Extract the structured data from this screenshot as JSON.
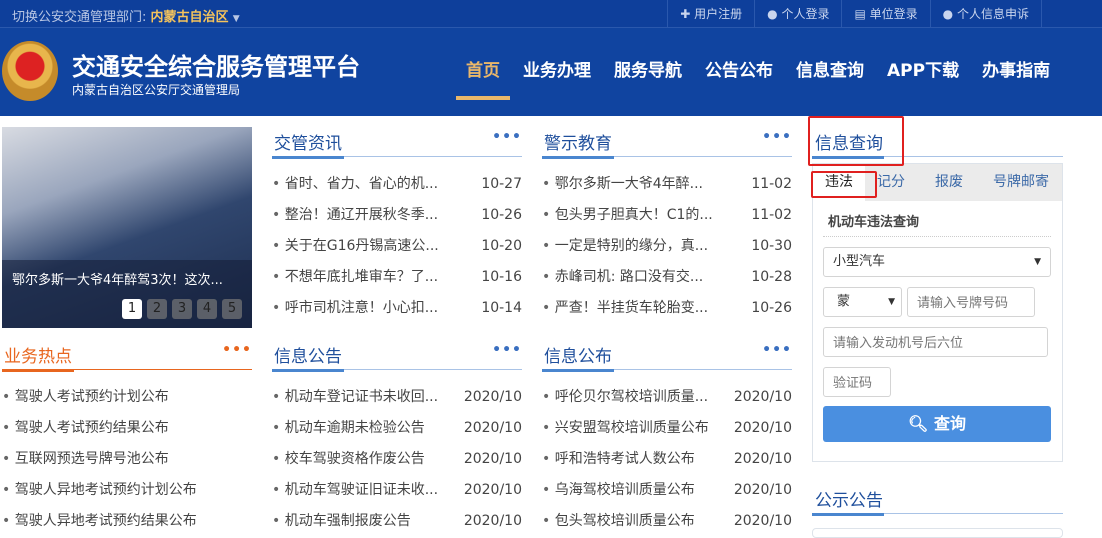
{
  "topbar": {
    "dept_label": "切换公安交通管理部门:",
    "dept_value": "内蒙古自治区",
    "links": [
      "用户注册",
      "个人登录",
      "单位登录",
      "个人信息申诉"
    ]
  },
  "header": {
    "title": "交通安全综合服务管理平台",
    "subtitle": "内蒙古自治区公安厅交通管理局",
    "nav": [
      "首页",
      "业务办理",
      "服务导航",
      "公告公布",
      "信息查询",
      "APP下载",
      "办事指南"
    ]
  },
  "carousel": {
    "caption": "鄂尔多斯一大爷4年醉驾3次！这次...",
    "pages": [
      "1",
      "2",
      "3",
      "4",
      "5"
    ],
    "active": 1
  },
  "more": "•••",
  "hot": {
    "title": "业务热点",
    "items": [
      "驾驶人考试预约计划公布",
      "驾驶人考试预约结果公布",
      "互联网预选号牌号池公布",
      "驾驶人异地考试预约计划公布",
      "驾驶人异地考试预约结果公布"
    ]
  },
  "news": {
    "title": "交管资讯",
    "items": [
      {
        "t": "省时、省力、省心的机...",
        "d": "10-27"
      },
      {
        "t": "整治！通辽开展秋冬季...",
        "d": "10-26"
      },
      {
        "t": "关于在G16丹锡高速公...",
        "d": "10-20"
      },
      {
        "t": "不想年底扎堆审车？了...",
        "d": "10-16"
      },
      {
        "t": "呼市司机注意！小心扣...",
        "d": "10-14"
      }
    ]
  },
  "warn": {
    "title": "警示教育",
    "items": [
      {
        "t": "鄂尔多斯一大爷4年醉...",
        "d": "11-02"
      },
      {
        "t": "包头男子胆真大！C1的...",
        "d": "11-02"
      },
      {
        "t": "一定是特别的缘分，真...",
        "d": "10-30"
      },
      {
        "t": "赤峰司机: 路口没有交...",
        "d": "10-28"
      },
      {
        "t": "严查！半挂货车轮胎变...",
        "d": "10-26"
      }
    ]
  },
  "notice": {
    "title": "信息公告",
    "items": [
      {
        "t": "机动车登记证书未收回...",
        "d": "2020/10"
      },
      {
        "t": "机动车逾期未检验公告",
        "d": "2020/10"
      },
      {
        "t": "校车驾驶资格作废公告",
        "d": "2020/10"
      },
      {
        "t": "机动车驾驶证旧证未收...",
        "d": "2020/10"
      },
      {
        "t": "机动车强制报废公告",
        "d": "2020/10"
      }
    ]
  },
  "publish": {
    "title": "信息公布",
    "items": [
      {
        "t": "呼伦贝尔驾校培训质量...",
        "d": "2020/10"
      },
      {
        "t": "兴安盟驾校培训质量公布",
        "d": "2020/10"
      },
      {
        "t": "呼和浩特考试人数公布",
        "d": "2020/10"
      },
      {
        "t": "乌海驾校培训质量公布",
        "d": "2020/10"
      },
      {
        "t": "包头驾校培训质量公布",
        "d": "2020/10"
      }
    ]
  },
  "query": {
    "title": "信息查询",
    "tabs": [
      "违法",
      "记分",
      "报废",
      "号牌邮寄"
    ],
    "form_title": "机动车违法查询",
    "vehicle_type": "小型汽车",
    "province": "蒙",
    "plate_placeholder": "请输入号牌号码",
    "engine_placeholder": "请输入发动机号后六位",
    "captcha_placeholder": "验证码",
    "submit": "查询"
  },
  "public": {
    "title": "公示公告"
  }
}
